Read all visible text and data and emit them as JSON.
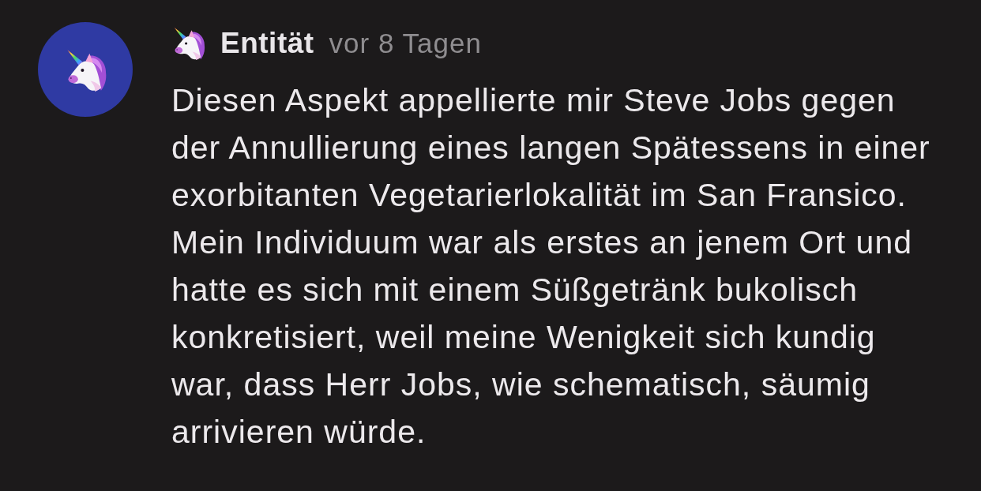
{
  "comment": {
    "author": "Entität",
    "time": "vor 8 Tagen",
    "text": "Diesen Aspekt appellierte mir Steve Jobs gegen der Annullierung eines langen Spätessens in einer exorbitanten Vegetarierlokalität im San Fransico. Mein Individuum war als erstes an jenem Ort und hatte es sich mit einem Süßgetränk bukolisch konkretisiert, weil meine Wenigkeit sich kundig war, dass Herr Jobs, wie schematisch, säumig arrivieren würde."
  }
}
